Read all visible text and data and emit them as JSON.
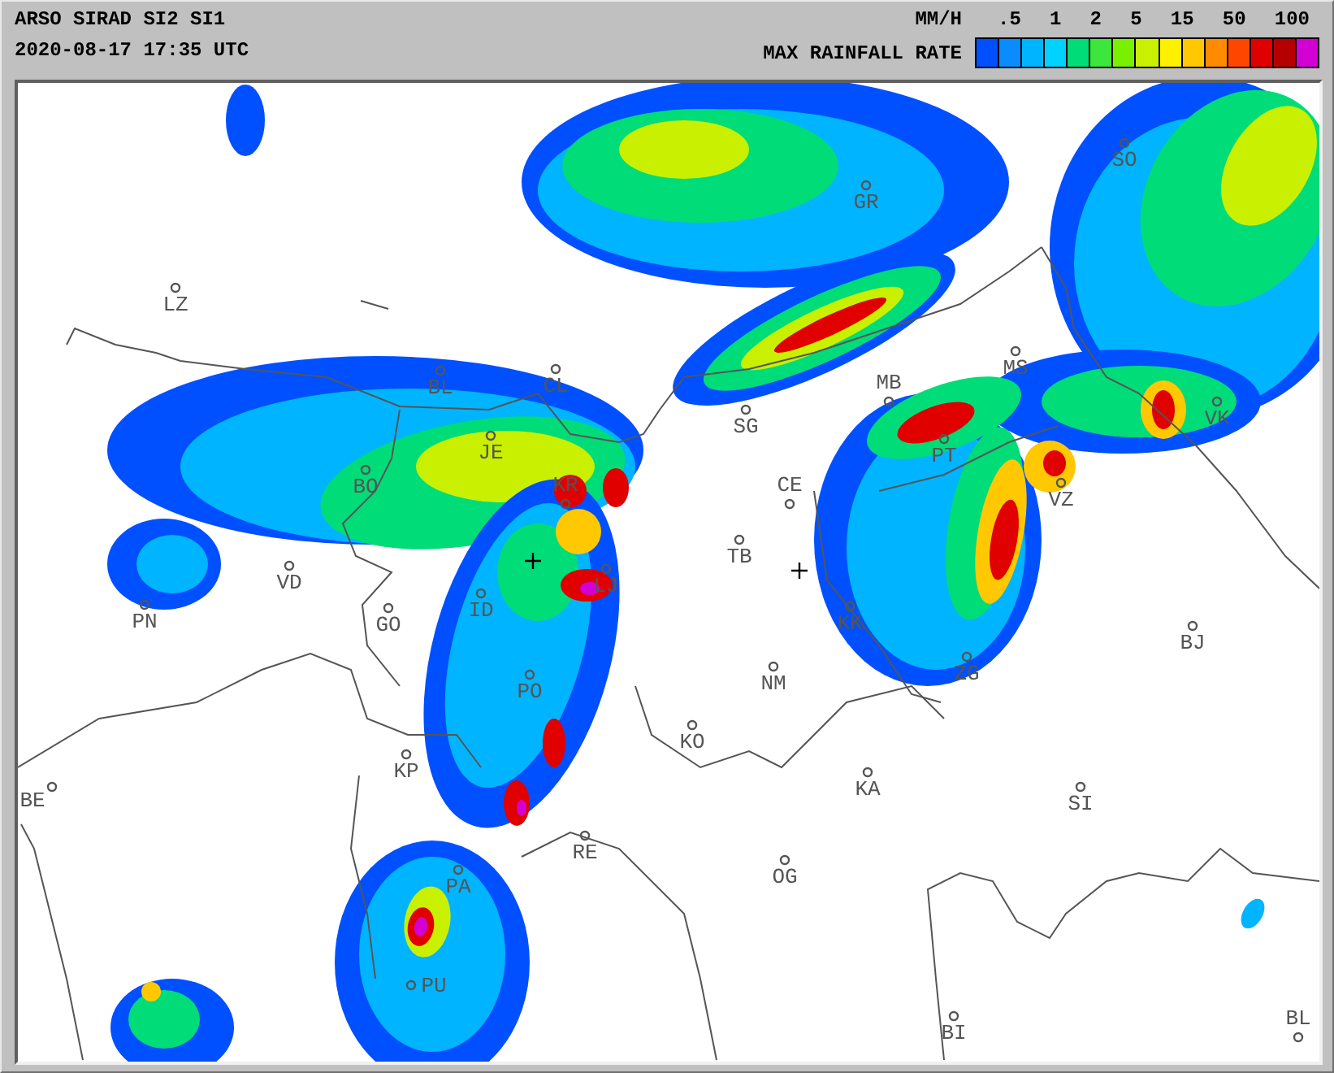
{
  "header": {
    "title": "ARSO SIRAD SI2 SI1",
    "timestamp": "2020-08-17 17:35 UTC"
  },
  "legend": {
    "unit": "MM/H",
    "caption": "MAX RAINFALL RATE",
    "scale": [
      ".5",
      "1",
      "2",
      "5",
      "15",
      "50",
      "100"
    ],
    "cells": [
      {
        "color": "#0050ff"
      },
      {
        "color": "#0a8cff"
      },
      {
        "color": "#00b4ff"
      },
      {
        "color": "#00d2ff"
      },
      {
        "color": "#00dc78"
      },
      {
        "color": "#3ce63c"
      },
      {
        "color": "#78f000"
      },
      {
        "color": "#c8f000"
      },
      {
        "color": "#fff000"
      },
      {
        "color": "#ffc800"
      },
      {
        "color": "#ff8c00"
      },
      {
        "color": "#ff4600"
      },
      {
        "color": "#e00000"
      },
      {
        "color": "#b40000"
      },
      {
        "color": "#d200d2"
      }
    ]
  },
  "cities": [
    {
      "code": "GR"
    },
    {
      "code": "SO"
    },
    {
      "code": "LZ"
    },
    {
      "code": "BL"
    },
    {
      "code": "CL"
    },
    {
      "code": "MS"
    },
    {
      "code": "MB"
    },
    {
      "code": "SG"
    },
    {
      "code": "VK"
    },
    {
      "code": "JE"
    },
    {
      "code": "PT"
    },
    {
      "code": "BO"
    },
    {
      "code": "KR"
    },
    {
      "code": "CE"
    },
    {
      "code": "VZ"
    },
    {
      "code": "TB"
    },
    {
      "code": "VD"
    },
    {
      "code": "LJ"
    },
    {
      "code": "ID"
    },
    {
      "code": "PN"
    },
    {
      "code": "GO"
    },
    {
      "code": "KK"
    },
    {
      "code": "BJ"
    },
    {
      "code": "ZG"
    },
    {
      "code": "NM"
    },
    {
      "code": "PO"
    },
    {
      "code": "KO"
    },
    {
      "code": "KP"
    },
    {
      "code": "KA"
    },
    {
      "code": "BE"
    },
    {
      "code": "SI"
    },
    {
      "code": "RE"
    },
    {
      "code": "OG"
    },
    {
      "code": "PA"
    },
    {
      "code": "PU"
    },
    {
      "code": "BI"
    },
    {
      "code": "BL"
    }
  ]
}
